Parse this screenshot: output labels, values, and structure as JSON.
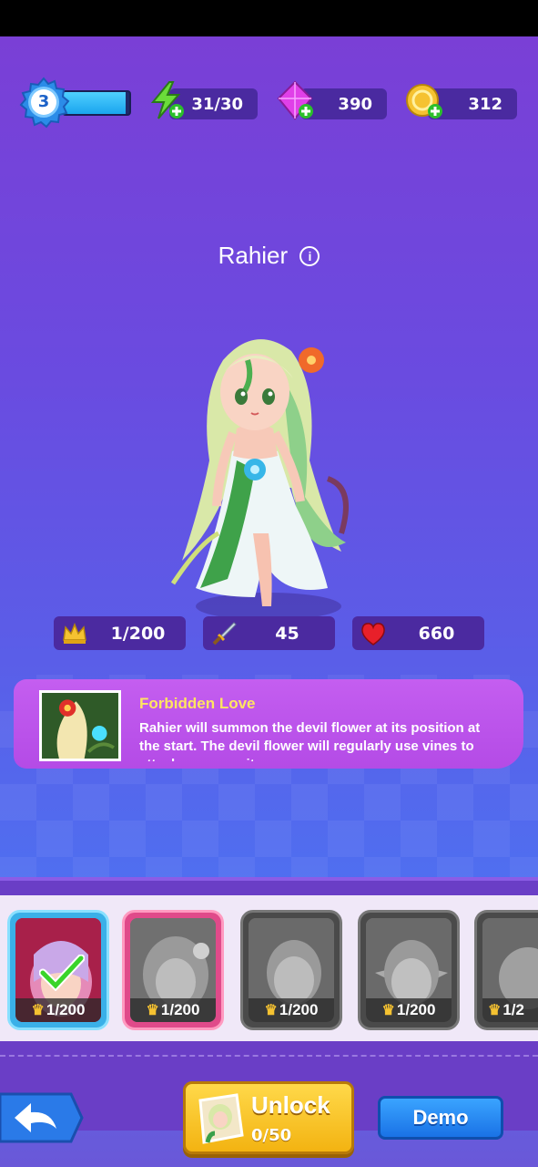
{
  "player": {
    "level": "3",
    "xp_progress": 0.95
  },
  "resources": {
    "energy": "31/30",
    "gems": "390",
    "coins": "312"
  },
  "hero": {
    "name": "Rahier",
    "stats": {
      "level": "1/200",
      "attack": "45",
      "health": "660"
    }
  },
  "skill": {
    "title": "Forbidden Love",
    "description": "Rahier will summon the devil flower at its position at the start. The devil flower will regularly use vines to attack enemy units."
  },
  "roster": [
    {
      "level": "1/200",
      "state": "selected-owned"
    },
    {
      "level": "1/200",
      "state": "current"
    },
    {
      "level": "1/200",
      "state": "locked"
    },
    {
      "level": "1/200",
      "state": "locked"
    },
    {
      "level": "1/2",
      "state": "locked"
    }
  ],
  "actions": {
    "unlock_label": "Unlock",
    "unlock_progress": "0/50",
    "demo_label": "Demo"
  },
  "colors": {
    "accent_gold": "#f5c231",
    "button_blue": "#1a72e6",
    "skill_title": "#ffe560"
  }
}
